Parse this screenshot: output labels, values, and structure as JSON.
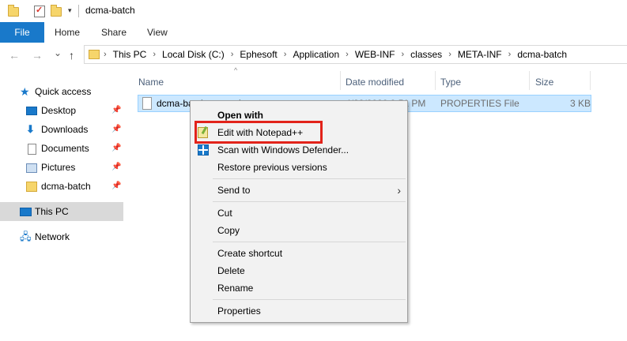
{
  "window": {
    "title": "dcma-batch"
  },
  "ribbon": {
    "tabs": [
      "File",
      "Home",
      "Share",
      "View"
    ]
  },
  "address": {
    "crumbs": [
      "This PC",
      "Local Disk (C:)",
      "Ephesoft",
      "Application",
      "WEB-INF",
      "classes",
      "META-INF",
      "dcma-batch"
    ]
  },
  "nav_buttons": {
    "back": "←",
    "forward": "→",
    "recent": "⌄",
    "up": "↑"
  },
  "sidebar": {
    "items": [
      {
        "label": "Quick access",
        "icon": "star-icon"
      },
      {
        "label": "Desktop",
        "icon": "desktop-icon",
        "pinned": true
      },
      {
        "label": "Downloads",
        "icon": "downloads-icon",
        "pinned": true
      },
      {
        "label": "Documents",
        "icon": "documents-icon",
        "pinned": true
      },
      {
        "label": "Pictures",
        "icon": "pictures-icon",
        "pinned": true
      },
      {
        "label": "dcma-batch",
        "icon": "folder-icon",
        "pinned": true
      },
      {
        "label": "This PC",
        "icon": "computer-icon",
        "selected": true
      },
      {
        "label": "Network",
        "icon": "network-icon"
      }
    ]
  },
  "columns": [
    "Name",
    "Date modified",
    "Type",
    "Size"
  ],
  "files": [
    {
      "name": "dcma-batch.properties",
      "date": "4/22/2020 9:51 PM",
      "type": "PROPERTIES File",
      "size": "3 KB"
    }
  ],
  "context_menu": {
    "items": [
      "Open with",
      "Edit with Notepad++",
      "Scan with Windows Defender...",
      "Restore previous versions",
      "Send to",
      "Cut",
      "Copy",
      "Create shortcut",
      "Delete",
      "Rename",
      "Properties"
    ]
  },
  "colors": {
    "accent": "#1979ca",
    "highlight_box": "#e2231a",
    "selection": "#cce8ff"
  }
}
